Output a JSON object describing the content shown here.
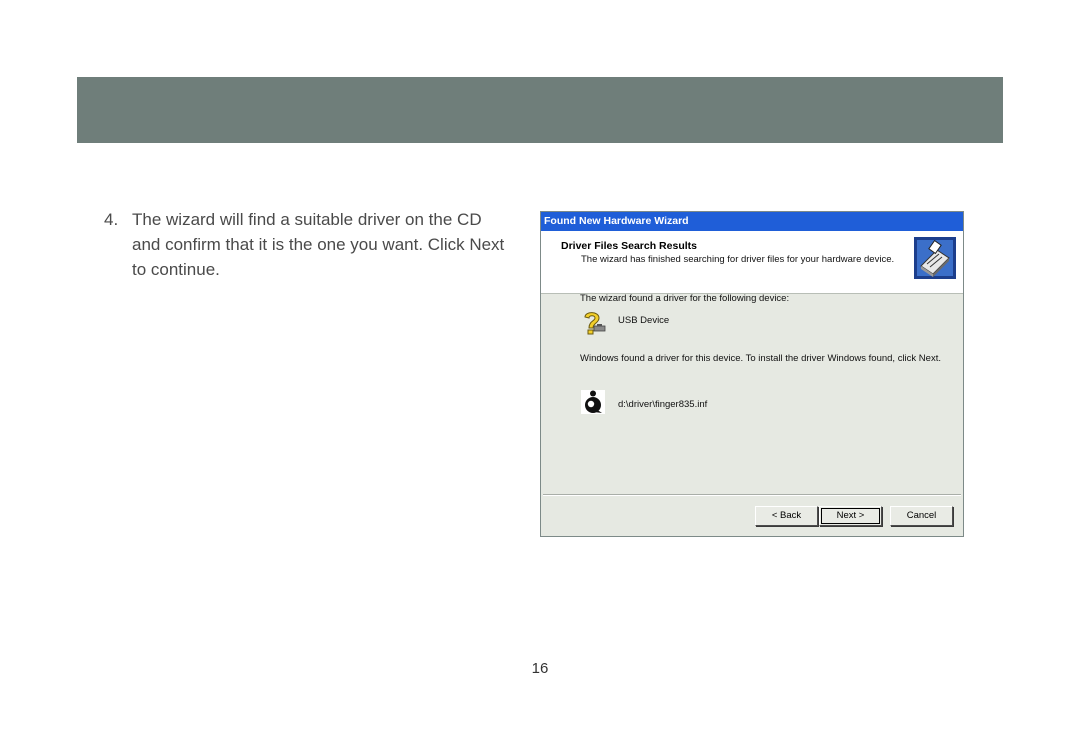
{
  "step": {
    "number": "4.",
    "text": "The wizard will find a suitable driver on the CD and confirm that it is the one you want.  Click Next to continue."
  },
  "dialog": {
    "title": "Found New Hardware Wizard",
    "header_title": "Driver Files Search Results",
    "header_subtitle": "The wizard has finished searching for driver files for your hardware device.",
    "found_text": "The wizard found a driver for the following device:",
    "device_name": "USB Device",
    "install_text": "Windows found a driver for this device. To install the driver Windows found, click Next.",
    "driver_path": "d:\\driver\\finger835.inf",
    "buttons": {
      "back": "< Back",
      "next": "Next >",
      "cancel": "Cancel"
    },
    "icons": {
      "header": "hardware-board-icon",
      "device": "unknown-device-question-icon",
      "driver_file": "inf-file-icon"
    }
  },
  "page_number": "16",
  "colors": {
    "header_band": "#6f7e7a",
    "titlebar": "#1f5ed8",
    "dialog_bg": "#e6e9e2"
  }
}
